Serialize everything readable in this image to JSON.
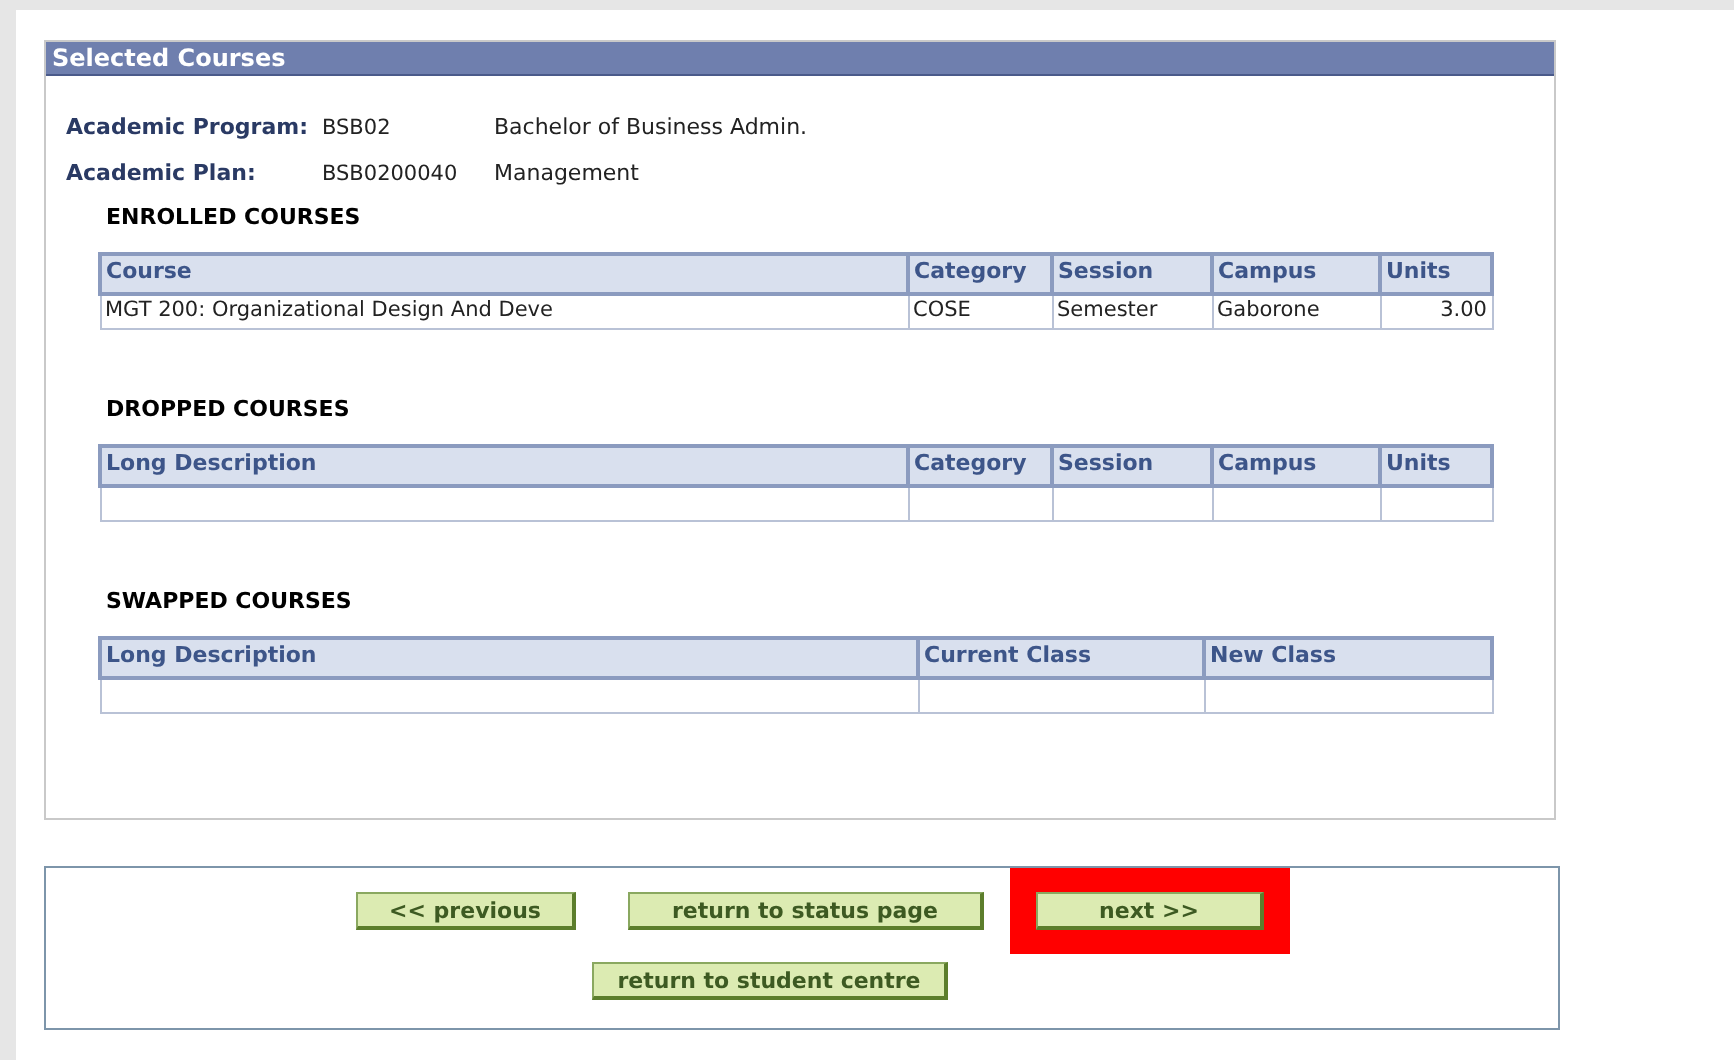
{
  "panel_title": "Selected Courses",
  "fields": [
    {
      "label": "Academic Program:",
      "code": "BSB02",
      "description": "Bachelor of Business Admin."
    },
    {
      "label": "Academic Plan:",
      "code": "BSB0200040",
      "description": "Management"
    }
  ],
  "sections": [
    {
      "title": "ENROLLED COURSES",
      "columns": [
        "Course",
        "Category",
        "Session",
        "Campus",
        "Units"
      ],
      "rows": [
        [
          "MGT  200: Organizational Design And Deve",
          "COSE",
          "Semester",
          "Gaborone",
          "3.00"
        ]
      ]
    },
    {
      "title": "DROPPED COURSES",
      "columns": [
        "Long Description",
        "Category",
        "Session",
        "Campus",
        "Units"
      ],
      "rows": [
        [
          "",
          "",
          "",
          "",
          ""
        ]
      ]
    },
    {
      "title": "SWAPPED COURSES",
      "columns": [
        "Long Description",
        "Current Class",
        "New Class"
      ],
      "rows": [
        [
          "",
          "",
          ""
        ]
      ]
    }
  ],
  "buttons": [
    [
      {
        "label": "<< previous",
        "highlighted": false
      },
      {
        "label": "return to status page",
        "highlighted": false
      },
      {
        "label": "next >>",
        "highlighted": true
      }
    ],
    [
      {
        "label": "return to student centre",
        "highlighted": false
      }
    ]
  ]
}
